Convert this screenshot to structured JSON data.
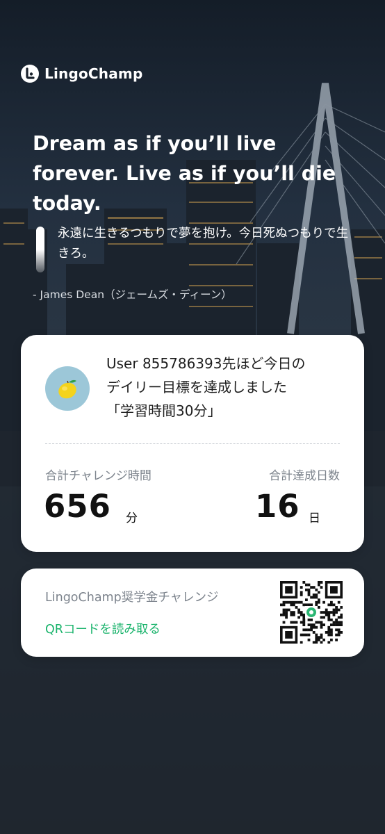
{
  "app": {
    "name": "LingoChamp"
  },
  "quote": {
    "english": "Dream as if you’ll live forever. Live as if you’ll die today.",
    "japanese": "永遠に生きるつもりで夢を抱け。今日死ぬつもりで生きろ。",
    "author": "- James Dean（ジェームズ・ディーン）"
  },
  "achievement": {
    "line1": "User 855786393先ほど今日の",
    "line2": "デイリー目標を達成しました",
    "line3": "「学習時間30分」",
    "avatar_icon": "lemon-icon"
  },
  "stats": {
    "time_label": "合計チャレンジ時間",
    "time_value": "656",
    "time_unit": "分",
    "days_label": "合計達成日数",
    "days_value": "16",
    "days_unit": "日"
  },
  "qr_card": {
    "title": "LingoChamp奨学金チャレンジ",
    "link": "QRコードを読み取る",
    "icon": "qr-code-icon"
  },
  "colors": {
    "accent_green": "#19b36b",
    "label_gray": "#7d848d",
    "avatar_bg": "#9cc7d8"
  }
}
